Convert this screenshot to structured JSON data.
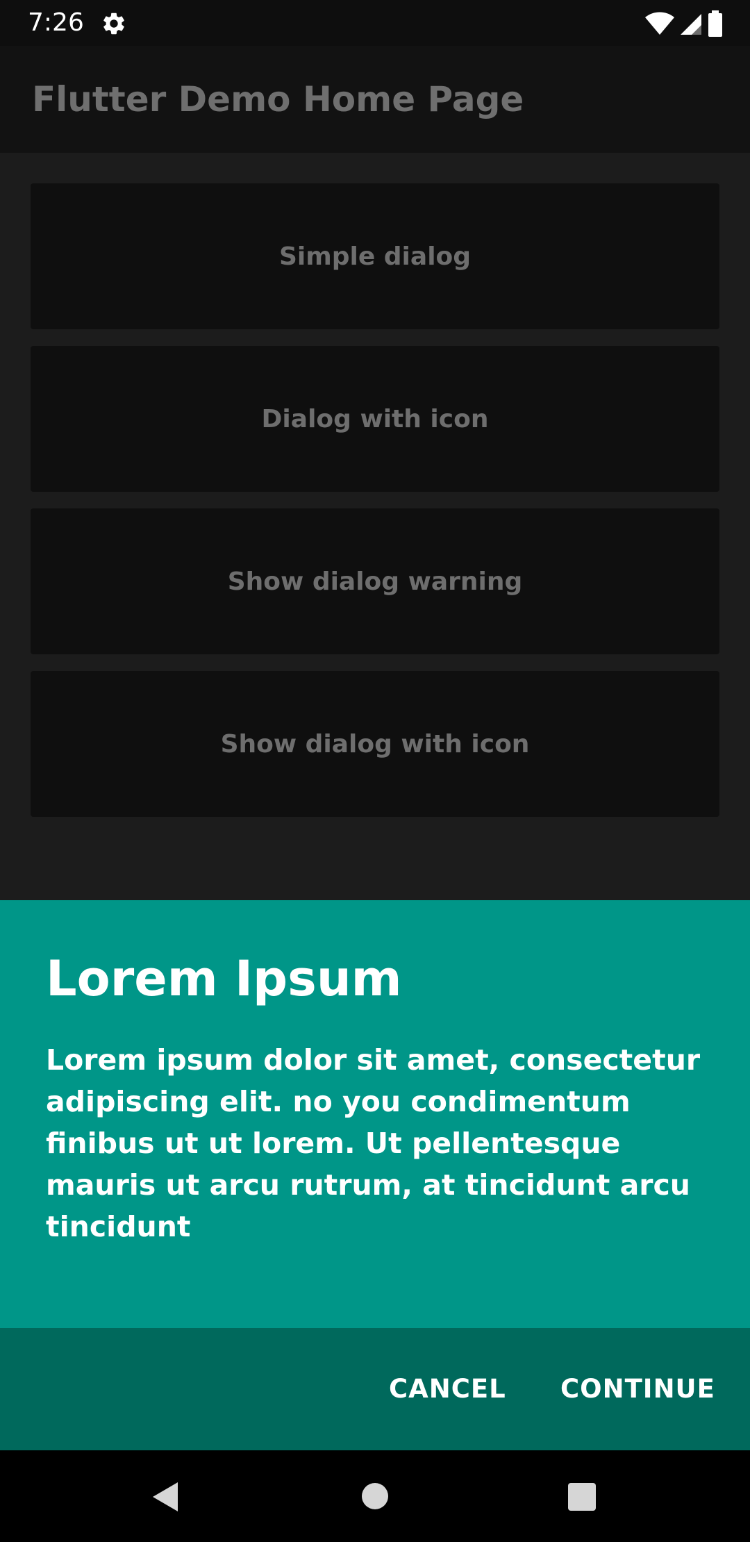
{
  "status_bar": {
    "time": "7:26",
    "icons": [
      "gear-icon",
      "wifi-icon",
      "signal-icon",
      "battery-icon"
    ]
  },
  "app_bar": {
    "title": "Flutter Demo Home Page"
  },
  "menu": {
    "items": [
      {
        "label": "Simple dialog"
      },
      {
        "label": "Dialog with icon"
      },
      {
        "label": "Show dialog warning"
      },
      {
        "label": "Show dialog with icon"
      }
    ]
  },
  "dialog": {
    "title": "Lorem Ipsum",
    "body": "Lorem ipsum dolor sit amet, consectetur adipiscing elit. no you condimentum finibus ut ut lorem. Ut pellentesque mauris ut arcu rutrum, at tincidunt arcu tincidunt",
    "cancel_label": "CANCEL",
    "continue_label": "CONTINUE",
    "background_color": "#009688",
    "actions_color": "#00695c"
  },
  "nav_bar": {
    "icons": [
      "back-icon",
      "home-icon",
      "recents-icon"
    ]
  }
}
